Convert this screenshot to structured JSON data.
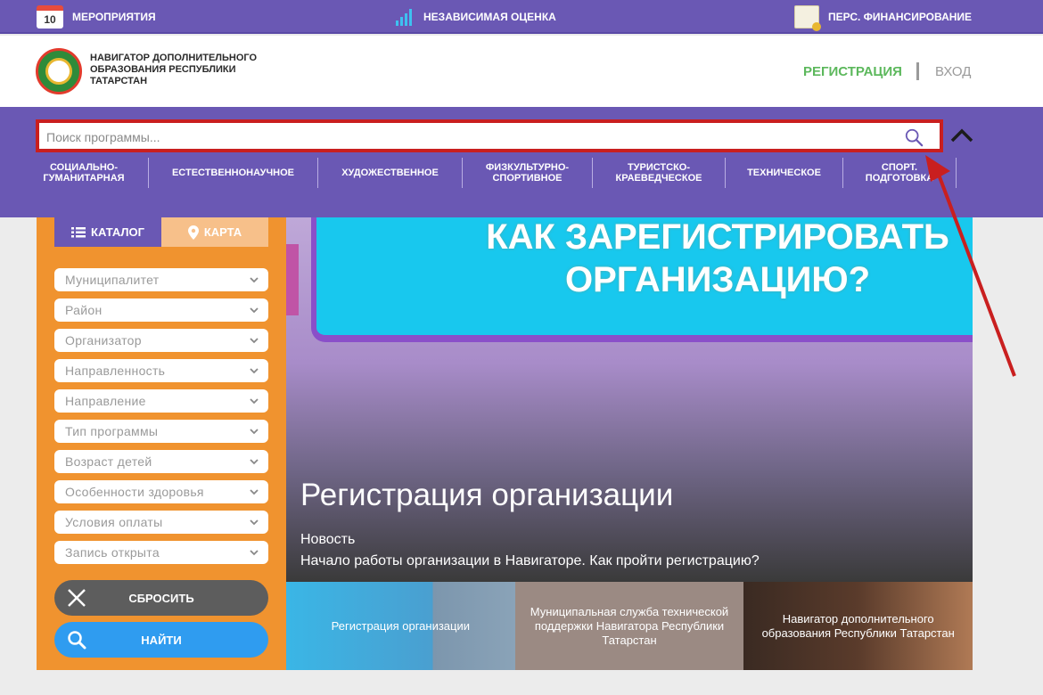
{
  "topbar": {
    "calendar_day": "10",
    "events_label": "МЕРОПРИЯТИЯ",
    "assessment_label": "НЕЗАВИСИМАЯ ОЦЕНКА",
    "financing_label": "ПЕРС. ФИНАНСИРОВАНИЕ"
  },
  "header": {
    "brand": "НАВИГАТОР ДОПОЛНИТЕЛЬНОГО ОБРАЗОВАНИЯ РЕСПУБЛИКИ ТАТАРСТАН",
    "register_label": "РЕГИСТРАЦИЯ",
    "login_label": "ВХОД"
  },
  "search": {
    "placeholder": "Поиск программы...",
    "value": ""
  },
  "categories": [
    "СОЦИАЛЬНО-ГУМАНИТАРНАЯ",
    "ЕСТЕСТВЕННОНАУЧНОЕ",
    "ХУДОЖЕСТВЕННОЕ",
    "ФИЗКУЛЬТУРНО-СПОРТИВНОЕ",
    "ТУРИСТСКО-КРАЕВЕДЧЕСКОЕ",
    "ТЕХНИЧЕСКОЕ",
    "СПОРТ. ПОДГОТОВКА"
  ],
  "sidebar": {
    "tab_catalog": "КАТАЛОГ",
    "tab_map": "КАРТА",
    "filters": [
      "Муниципалитет",
      "Район",
      "Организатор",
      "Направленность",
      "Направление",
      "Тип программы",
      "Возраст детей",
      "Особенности здоровья",
      "Условия оплаты",
      "Запись открыта"
    ],
    "reset_label": "СБРОСИТЬ",
    "find_label": "НАЙТИ"
  },
  "banner": {
    "image_text": "КАК ЗАРЕГИСТРИРОВАТЬ ОРГАНИЗАЦИЮ?",
    "title": "Регистрация организации",
    "kind": "Новость",
    "description": "Начало работы организации в Навигаторе. Как пройти регистрацию?"
  },
  "thumbnails": [
    "Регистрация организации",
    "Муниципальная служба технической поддержки Навигатора Республики Татарстан",
    "Навигатор дополнительного образования Республики Татарстан"
  ],
  "colors": {
    "primary_purple": "#6a58b4",
    "sidebar_orange": "#f0932f",
    "register_green": "#5cb85c",
    "highlight_red": "#c91f1f",
    "find_blue": "#2f9cf0"
  }
}
